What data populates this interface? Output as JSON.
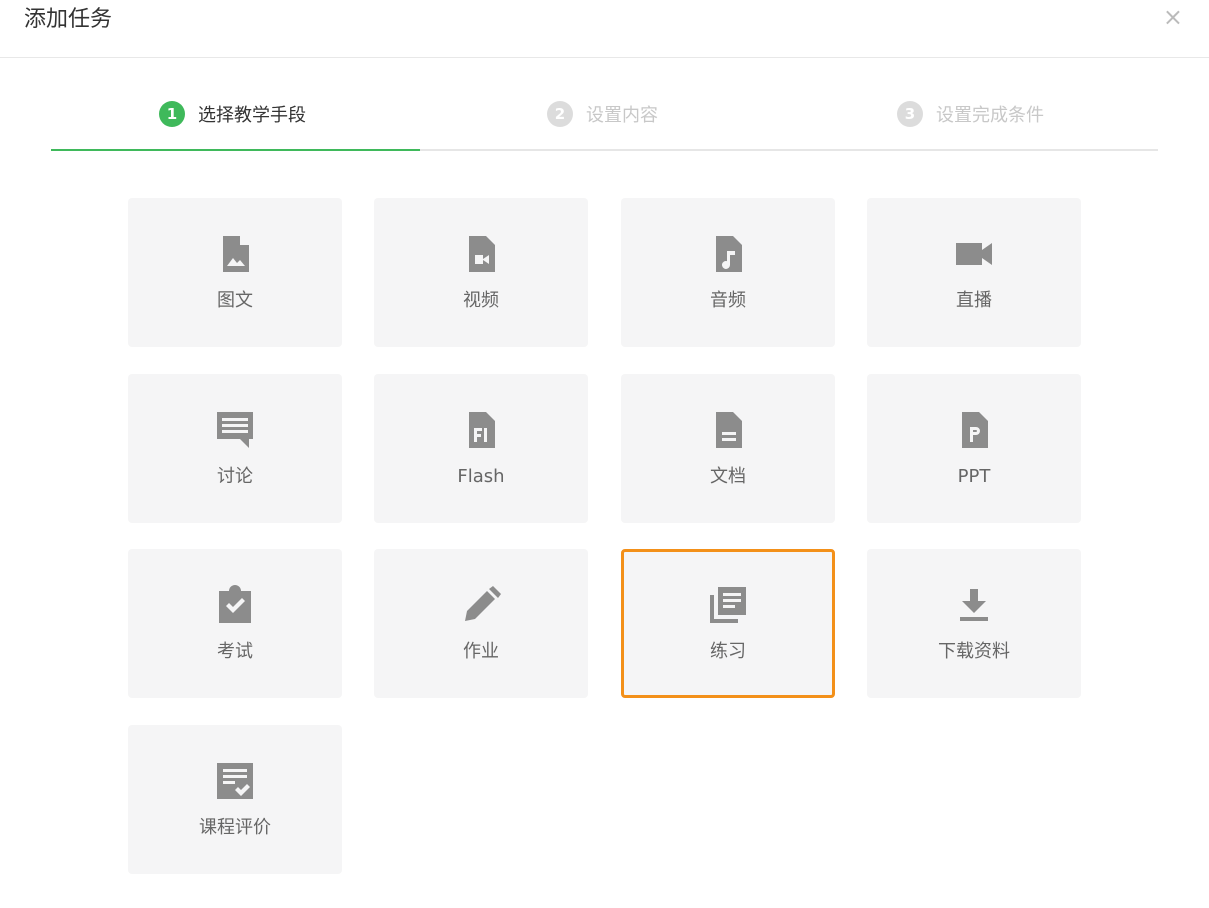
{
  "dialog": {
    "title": "添加任务",
    "close_glyph": "×"
  },
  "steps": [
    {
      "num": "1",
      "label": "选择教学手段",
      "state": "active"
    },
    {
      "num": "2",
      "label": "设置内容",
      "state": "inactive"
    },
    {
      "num": "3",
      "label": "设置完成条件",
      "state": "inactive"
    }
  ],
  "colors": {
    "accent_green": "#3fb95b",
    "selected_orange": "#f39019",
    "tile_bg": "#f5f5f6",
    "icon_gray": "#8c8c8c"
  },
  "tiles": [
    {
      "label": "图文",
      "icon": "file-image-icon"
    },
    {
      "label": "视频",
      "icon": "file-video-icon"
    },
    {
      "label": "音频",
      "icon": "file-audio-icon"
    },
    {
      "label": "直播",
      "icon": "video-camera-icon"
    },
    {
      "label": "讨论",
      "icon": "comment-icon"
    },
    {
      "label": "Flash",
      "icon": "file-flash-icon"
    },
    {
      "label": "文档",
      "icon": "file-document-icon"
    },
    {
      "label": "PPT",
      "icon": "file-ppt-icon"
    },
    {
      "label": "考试",
      "icon": "clipboard-check-icon"
    },
    {
      "label": "作业",
      "icon": "pencil-icon"
    },
    {
      "label": "练习",
      "icon": "library-books-icon",
      "selected": true
    },
    {
      "label": "下载资料",
      "icon": "download-icon"
    },
    {
      "label": "课程评价",
      "icon": "checklist-icon"
    }
  ]
}
